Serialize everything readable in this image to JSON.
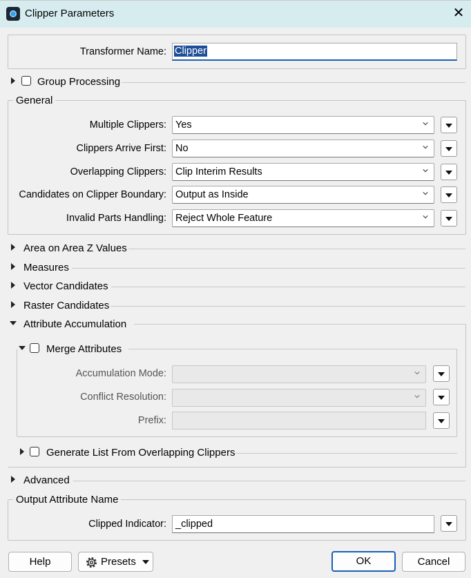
{
  "window": {
    "title": "Clipper Parameters"
  },
  "transformer": {
    "label": "Transformer Name:",
    "value": "Clipper"
  },
  "sections": {
    "group_processing": "Group Processing",
    "general": "General",
    "area_on_area_z": "Area on Area Z Values",
    "measures": "Measures",
    "vector_candidates": "Vector Candidates",
    "raster_candidates": "Raster Candidates",
    "attribute_accumulation": "Attribute Accumulation",
    "merge_attributes": "Merge Attributes",
    "generate_list": "Generate List From Overlapping Clippers",
    "advanced": "Advanced",
    "output_attribute_name": "Output Attribute Name"
  },
  "general": {
    "multiple_clippers": {
      "label": "Multiple Clippers:",
      "value": "Yes"
    },
    "clippers_arrive_first": {
      "label": "Clippers Arrive First:",
      "value": "No"
    },
    "overlapping_clippers": {
      "label": "Overlapping Clippers:",
      "value": "Clip Interim Results"
    },
    "candidates_on_boundary": {
      "label": "Candidates on Clipper Boundary:",
      "value": "Output as Inside"
    },
    "invalid_parts": {
      "label": "Invalid Parts Handling:",
      "value": "Reject Whole Feature"
    }
  },
  "merge": {
    "accumulation_mode": {
      "label": "Accumulation Mode:",
      "value": ""
    },
    "conflict_resolution": {
      "label": "Conflict Resolution:",
      "value": ""
    },
    "prefix": {
      "label": "Prefix:",
      "value": ""
    }
  },
  "output": {
    "clipped_indicator": {
      "label": "Clipped Indicator:",
      "value": "_clipped"
    }
  },
  "footer": {
    "help": "Help",
    "presets": "Presets",
    "ok": "OK",
    "cancel": "Cancel"
  },
  "colors": {
    "accent": "#1a5fb4",
    "titlebar": "#d7ecef",
    "selection": "#1f4e98"
  }
}
